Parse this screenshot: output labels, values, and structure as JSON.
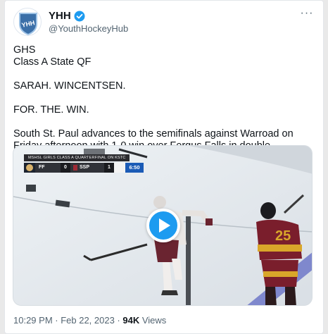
{
  "tweet": {
    "author": {
      "display_name": "YHH",
      "handle": "@YouthHockeyHub",
      "avatar_text": "YHH",
      "verified": true
    },
    "lines": [
      "GHS",
      "Class A State QF",
      "",
      "SARAH. WINCENTSEN.",
      "",
      "FOR. THE. WIN.",
      "",
      "South St. Paul advances to the semifinals against Warroad on Friday afternoon with 1-0 win over Fergus Falls in double overtime."
    ],
    "timestamp": "10:29 PM · Feb 22, 2023 · ",
    "views_count": "94K",
    "views_label": " Views"
  },
  "video": {
    "scorebug": {
      "title": "MSHSL GIRLS CLASS A QUARTERFINAL ON KSTC",
      "team1": "FF",
      "score1": "0",
      "team2": "SSP",
      "score2": "1",
      "period": "",
      "clock": "6:50"
    },
    "jersey_number": "25"
  },
  "colors": {
    "accent": "#1d9bf0",
    "clock_bg": "#1b5bb6",
    "maroon": "#7a1e2c",
    "gold": "#d9a62a"
  },
  "icons": {
    "verified": "verified-badge-icon",
    "more": "more-dots-icon",
    "play": "play-icon"
  }
}
